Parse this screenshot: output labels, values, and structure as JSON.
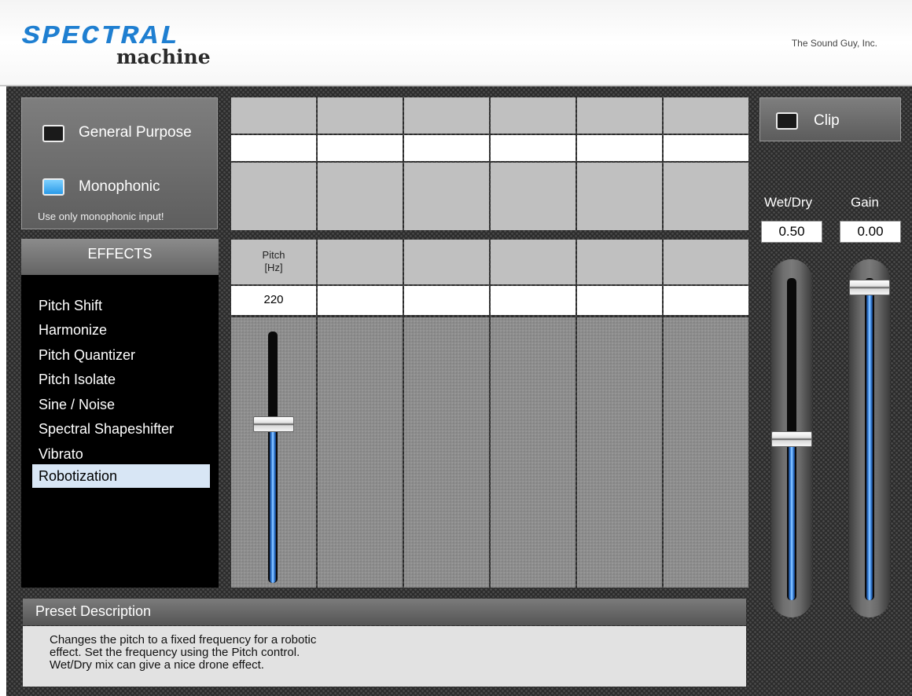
{
  "header": {
    "logo_word": "SPECTRAL",
    "logo_sub": "machine",
    "company": "The Sound Guy, Inc."
  },
  "modes": {
    "general_purpose": {
      "label": "General Purpose",
      "checked": false
    },
    "monophonic": {
      "label": "Monophonic",
      "checked": true
    },
    "note": "Use only monophonic input!"
  },
  "effects": {
    "header": "EFFECTS",
    "items": [
      "Pitch Shift",
      "Harmonize",
      "Pitch Quantizer",
      "Pitch Isolate",
      "Sine / Noise",
      "Spectral Shapeshifter",
      "Vibrato",
      "Robotization"
    ],
    "selected": "Robotization"
  },
  "parameters": [
    {
      "name_line1": "Pitch",
      "name_line2": "[Hz]",
      "value": "220",
      "slider_fraction": 0.63
    },
    {
      "name_line1": "",
      "name_line2": "",
      "value": ""
    },
    {
      "name_line1": "",
      "name_line2": "",
      "value": ""
    },
    {
      "name_line1": "",
      "name_line2": "",
      "value": ""
    },
    {
      "name_line1": "",
      "name_line2": "",
      "value": ""
    },
    {
      "name_line1": "",
      "name_line2": "",
      "value": ""
    }
  ],
  "clip": {
    "label": "Clip",
    "checked": false
  },
  "wet_dry": {
    "label": "Wet/Dry",
    "value": "0.50",
    "fraction": 0.5
  },
  "gain": {
    "label": "Gain",
    "value": "0.00",
    "fraction": 0.97
  },
  "preset": {
    "header": "Preset Description",
    "text": "Changes the pitch to a fixed frequency for a robotic\neffect. Set the frequency using the Pitch control.\nWet/Dry mix can give a nice drone effect."
  },
  "colors": {
    "accent_blue": "#2a8cf0",
    "selected_item": "#d8e6f5",
    "panel_dark": "#2c2c2c"
  }
}
